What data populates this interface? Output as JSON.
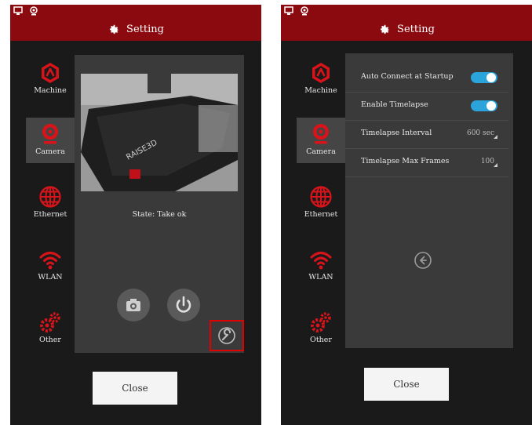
{
  "title": "Setting",
  "colors": {
    "header": "#8b0a0f",
    "accent_red": "#d8141a",
    "toggle_on": "#2ba3db"
  },
  "nav": [
    {
      "label": "Machine",
      "icon": "machine-icon"
    },
    {
      "label": "Camera",
      "icon": "camera-icon"
    },
    {
      "label": "Ethernet",
      "icon": "globe-icon"
    },
    {
      "label": "WLAN",
      "icon": "wifi-icon"
    },
    {
      "label": "Other",
      "icon": "gears-icon"
    }
  ],
  "camera_screen": {
    "state_text": "State: Take ok",
    "photo_icon": "camera-capture-icon",
    "power_icon": "power-icon",
    "settings_icon": "wrench-icon"
  },
  "settings_screen": {
    "rows": [
      {
        "label": "Auto Connect at Startup",
        "toggle_on": true
      },
      {
        "label": "Enable Timelapse",
        "toggle_on": true
      },
      {
        "label": "Timelapse Interval",
        "value": "600 sec"
      },
      {
        "label": "Timelapse Max Frames",
        "value": "100"
      }
    ],
    "back_icon": "back-arrow-icon"
  },
  "close_label": "Close"
}
